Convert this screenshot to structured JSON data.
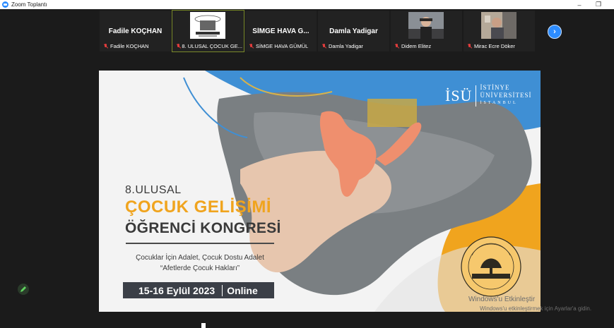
{
  "window": {
    "title": "Zoom Toplantı",
    "minimize_glyph": "–",
    "restore_glyph": "❐"
  },
  "participants": [
    {
      "display": "Fadile KOÇHAN",
      "label": "Fadile KOÇHAN",
      "type": "name"
    },
    {
      "display": "",
      "label": "8. ULUSAL ÇOCUK GE...",
      "type": "image"
    },
    {
      "display": "SİMGE HAVA G...",
      "label": "SİMGE HAVA GÜMÜL",
      "type": "name"
    },
    {
      "display": "Damla Yadigar",
      "label": "Damla Yadigar",
      "type": "name"
    },
    {
      "display": "",
      "label": "Didem Elitez",
      "type": "image"
    },
    {
      "display": "",
      "label": "Mirac Ecre Döker",
      "type": "image"
    }
  ],
  "next_page_glyph": "›",
  "slide": {
    "edition": "8.ULUSAL",
    "title_line1": "ÇOCUK GELİŞİMİ",
    "title_line2": "ÖĞRENCİ KONGRESİ",
    "subtitle1": "Çocuklar İçin Adalet, Çocuk Dostu Adalet",
    "subtitle2": "“Afetlerde Çocuk Hakları”",
    "date": "15-16 Eylül 2023",
    "mode": "Online",
    "logo_abbrev": "İSÜ",
    "logo_line1": "İSTİNYE",
    "logo_line2": "ÜNİVERSİTESİ",
    "logo_line3": "İSTANBUL",
    "seal_top": "İSTİNYE ÜNİVERSİTESİ",
    "seal_banner": "ÇOCUKLAR İÇİN ADALET"
  },
  "watermark": {
    "line1": "Windows'u Etkinleştir",
    "line2": "Windows'u etkinleştirmek için Ayarlar'a gidin."
  },
  "colors": {
    "accent_orange": "#f0a41e",
    "accent_blue": "#3f8fd4",
    "zoom_blue": "#2d8cff",
    "muted_red": "#e23c3c"
  }
}
